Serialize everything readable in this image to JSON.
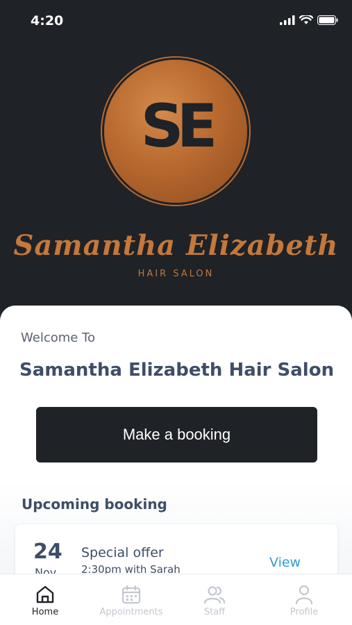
{
  "status_bar": {
    "time": "4:20"
  },
  "hero": {
    "monogram": "SE",
    "brand_name": "Samantha Elizabeth",
    "brand_sub": "HAIR SALON",
    "brand_color": "#c5783a"
  },
  "main": {
    "welcome": "Welcome To",
    "salon_name": "Samantha Elizabeth Hair Salon",
    "book_button": "Make a booking",
    "upcoming_title": "Upcoming booking",
    "booking": {
      "day": "24",
      "month": "Nov",
      "title": "Special offer",
      "detail": "2:30pm with Sarah",
      "view_label": "View"
    }
  },
  "tabbar": {
    "items": [
      {
        "label": "Home",
        "icon": "home-icon",
        "active": true
      },
      {
        "label": "Appointments",
        "icon": "calendar-icon",
        "active": false
      },
      {
        "label": "Staff",
        "icon": "users-icon",
        "active": false
      },
      {
        "label": "Profile",
        "icon": "user-icon",
        "active": false
      }
    ]
  },
  "colors": {
    "dark": "#1f2227",
    "text": "#3e4e68",
    "link": "#2e9fd0",
    "inactive": "#c3c7cf"
  }
}
